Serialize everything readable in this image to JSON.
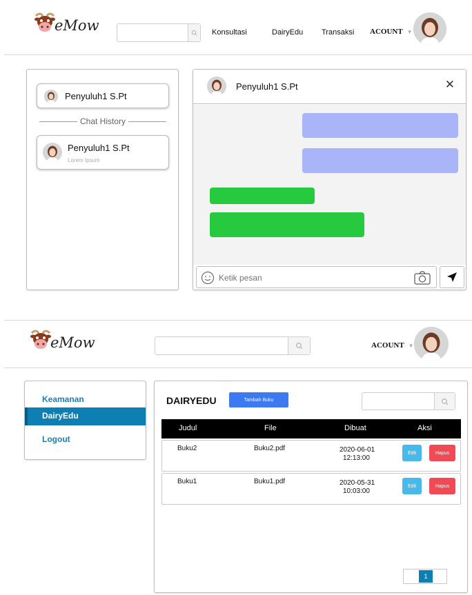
{
  "brand": {
    "name": "eMow",
    "logo_icon": "cow-head-icon"
  },
  "screen1": {
    "header": {
      "search": {
        "placeholder": ""
      },
      "nav": [
        "Konsultasi",
        "DairyEdu",
        "Transaksi"
      ],
      "account_label": "ACOUNT"
    },
    "contacts": {
      "top_card_name": "Penyuluh1 S.Pt",
      "history_label": "Chat History",
      "history_items": [
        {
          "name": "Penyuluh1 S.Pt",
          "preview": "Lorem Ipsum"
        }
      ]
    },
    "chat": {
      "title": "Penyuluh1 S.Pt",
      "close_glyph": "✕",
      "composer_placeholder": "Ketik pesan"
    },
    "colors": {
      "outgoing": "#aab4f8",
      "incoming": "#27c93f"
    }
  },
  "screen2": {
    "header": {
      "search": {
        "placeholder": ""
      },
      "account_label": "ACOUNT"
    },
    "sidebar": {
      "items": [
        "Keamanan",
        "DairyEdu",
        "Logout"
      ],
      "active": "DairyEdu"
    },
    "main": {
      "title": "DAIRYEDU",
      "add_button": "Tambah Buku",
      "search": {
        "placeholder": ""
      },
      "table": {
        "columns": [
          "Judul",
          "File",
          "Dibuat",
          "Aksi"
        ],
        "rows": [
          {
            "judul": "Buku2",
            "file": "Buku2.pdf",
            "date": "2020-06-01",
            "time": "12:13:00",
            "edit": "Edit",
            "delete": "Hapus"
          },
          {
            "judul": "Buku1",
            "file": "Buku1.pdf",
            "date": "2020-05-31",
            "time": "10:03:00",
            "edit": "Edit",
            "delete": "Hapus"
          }
        ]
      },
      "pagination": {
        "current": "1"
      }
    },
    "colors": {
      "accent": "#0d7fb3",
      "add_button": "#3d79f0",
      "edit": "#47b9ea",
      "delete": "#f04b55"
    }
  }
}
